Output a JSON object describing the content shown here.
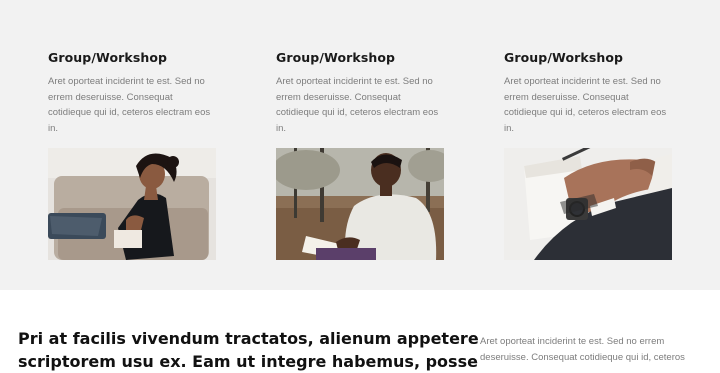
{
  "services": {
    "cards": [
      {
        "title": "Group/Workshop",
        "description": "Aret oporteat inciderint te est. Sed no errem deseruisse. Consequat cotidieque qui id, ceteros electram eos in.",
        "image": "woman-reading-on-couch-photo"
      },
      {
        "title": "Group/Workshop",
        "description": "Aret oporteat inciderint te est. Sed no errem deseruisse. Consequat cotidieque qui id, ceteros electram eos in.",
        "image": "man-reading-in-park-photo"
      },
      {
        "title": "Group/Workshop",
        "description": "Aret oporteat inciderint te est. Sed no errem deseruisse. Consequat cotidieque qui id, ceteros electram eos in.",
        "image": "hand-with-wristwatch-photo"
      }
    ]
  },
  "intro": {
    "headline_line1": "Pri at facilis vivendum tractatos, alienum appetere",
    "headline_line2": "scriptorem usu ex. Eam ut integre habemus, posse",
    "side_line1": "Aret oporteat inciderint te est. Sed no errem",
    "side_line2": "deseruisse. Consequat cotidieque qui id, ceteros"
  }
}
